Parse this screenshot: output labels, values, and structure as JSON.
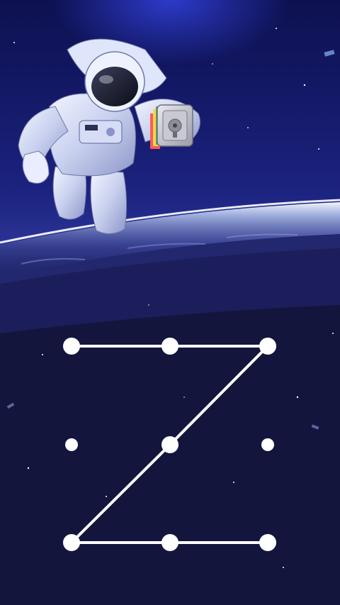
{
  "screen": {
    "type": "pattern-lock",
    "background_theme": "space-astronaut-over-earth",
    "colors": {
      "space_top": "#0a0f4a",
      "space_mid": "#1a1f7a",
      "horizon_glow": "#c9dcff",
      "planet": "#2a2e7a",
      "ground_dark": "#0c0d2c",
      "pattern_line": "#ffffff",
      "pattern_dot": "#ffffff"
    }
  },
  "astronaut": {
    "holding": "app-lock-vault-icon"
  },
  "pattern": {
    "grid": [
      3,
      3
    ],
    "dots": [
      {
        "id": "r1c1",
        "selected": true
      },
      {
        "id": "r1c2",
        "selected": true
      },
      {
        "id": "r1c3",
        "selected": true
      },
      {
        "id": "r2c1",
        "selected": false
      },
      {
        "id": "r2c2",
        "selected": true
      },
      {
        "id": "r2c3",
        "selected": false
      },
      {
        "id": "r3c1",
        "selected": true
      },
      {
        "id": "r3c2",
        "selected": true
      },
      {
        "id": "r3c3",
        "selected": true
      }
    ],
    "path": [
      "r1c1",
      "r1c2",
      "r1c3",
      "r2c2",
      "r3c1",
      "r3c2",
      "r3c3"
    ]
  }
}
